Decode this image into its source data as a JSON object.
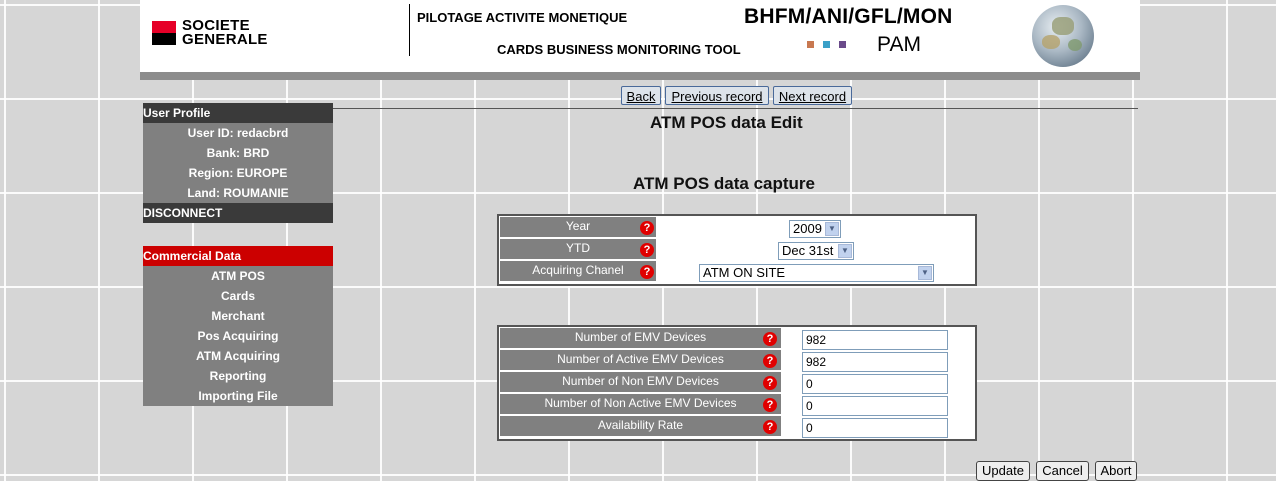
{
  "header": {
    "logo_line1": "SOCIETE",
    "logo_line2": "GENERALE",
    "title_line1": "PILOTAGE ACTIVITE MONETIQUE",
    "title_line2": "CARDS BUSINESS MONITORING TOOL",
    "code": "BHFM/ANI/GFL/MON",
    "app": "PAM",
    "square_colors": [
      "#c87850",
      "#3aa0c8",
      "#6a4a8a"
    ]
  },
  "nav": {
    "back": "Back",
    "previous": "Previous record",
    "next": "Next record"
  },
  "user_profile": {
    "heading": "User Profile",
    "user_id": "User ID: redacbrd",
    "bank": "Bank: BRD",
    "region": "Region: EUROPE",
    "land": "Land: ROUMANIE",
    "disconnect": "DISCONNECT"
  },
  "commercial": {
    "heading": "Commercial Data",
    "items": [
      "ATM POS",
      "Cards",
      "Merchant",
      "Pos Acquiring",
      "ATM Acquiring",
      "Reporting",
      "Importing File"
    ]
  },
  "page": {
    "title": "ATM POS data Edit",
    "subtitle": "ATM POS data capture"
  },
  "filters": {
    "year_label": "Year",
    "year_value": "2009",
    "ytd_label": "YTD",
    "ytd_value": "Dec 31st",
    "channel_label": "Acquiring Chanel",
    "channel_value": "ATM ON SITE"
  },
  "fields": [
    {
      "label": "Number of EMV Devices",
      "value": "982"
    },
    {
      "label": "Number of Active EMV Devices",
      "value": "982"
    },
    {
      "label": "Number of Non EMV Devices",
      "value": "0"
    },
    {
      "label": "Number of Non Active EMV Devices",
      "value": "0"
    },
    {
      "label": "Availability Rate",
      "value": "0"
    }
  ],
  "help_glyph": "?",
  "actions": {
    "update": "Update",
    "cancel": "Cancel",
    "abort": "Abort"
  }
}
